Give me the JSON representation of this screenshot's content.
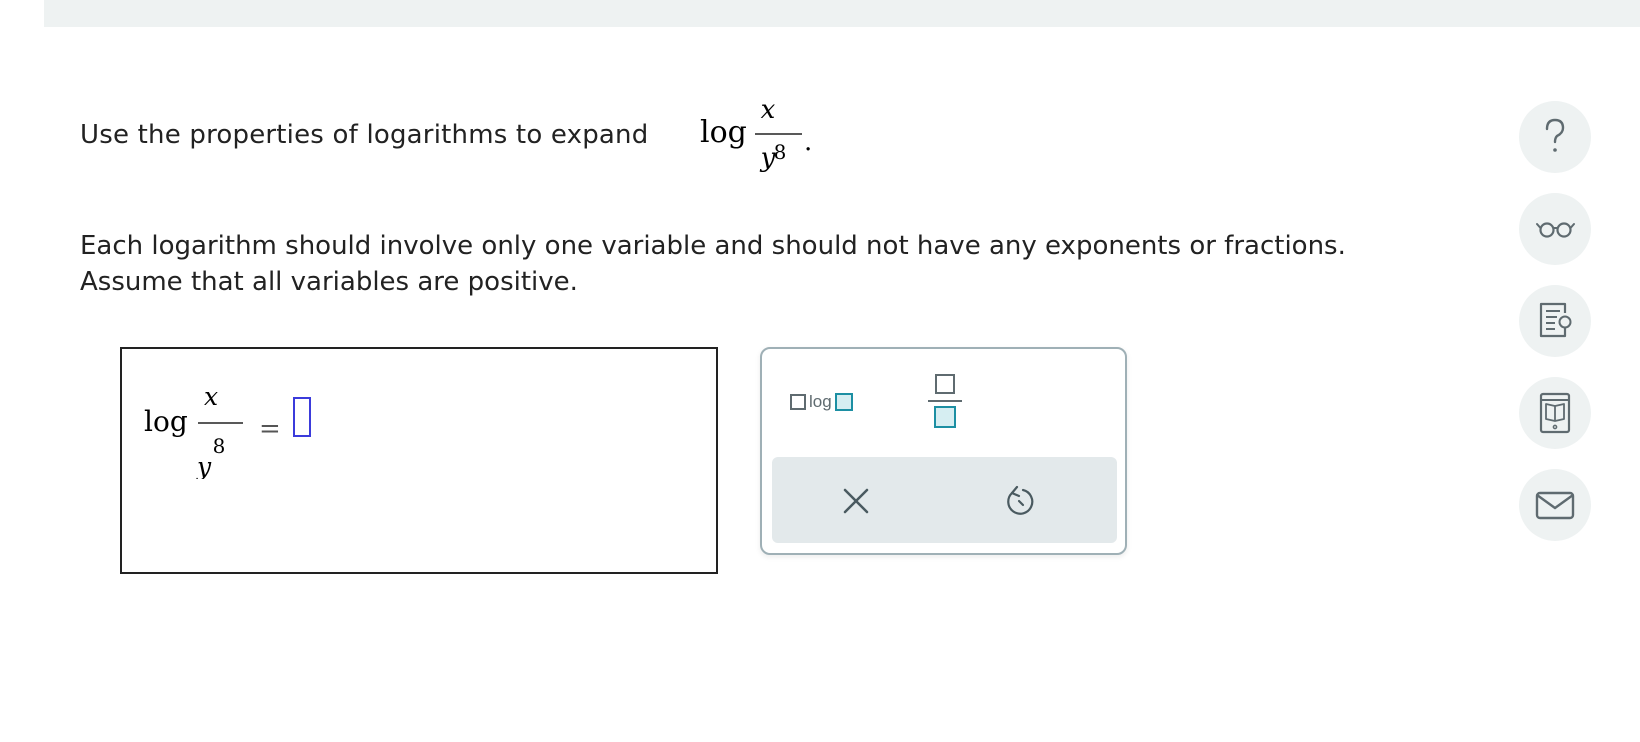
{
  "question": {
    "prompt_text": "Use the properties of logarithms to expand",
    "expression": {
      "func": "log",
      "numerator": "x",
      "denominator_base": "y",
      "denominator_exponent": "8"
    },
    "period": ".",
    "instructions_line1": "Each logarithm should involve only one variable and should not have any exponents or fractions.",
    "instructions_line2": "Assume that all variables are positive."
  },
  "answer": {
    "func": "log",
    "numerator": "x",
    "denominator_base": "y",
    "denominator_exponent": "8",
    "equals": "="
  },
  "palette": {
    "log_label": "log",
    "buttons": [
      "log-template-button",
      "fraction-template-button",
      "clear-button",
      "undo-button"
    ]
  },
  "sidebar": {
    "icons": [
      "help-icon",
      "glasses-icon",
      "worksheet-icon",
      "textbook-icon",
      "mail-icon"
    ]
  },
  "colors": {
    "answer_slot": "#3b3bdb",
    "palette_accent": "#1c8fa3",
    "icon_gray": "#5f6b70",
    "side_button_bg": "#eef2f2"
  }
}
